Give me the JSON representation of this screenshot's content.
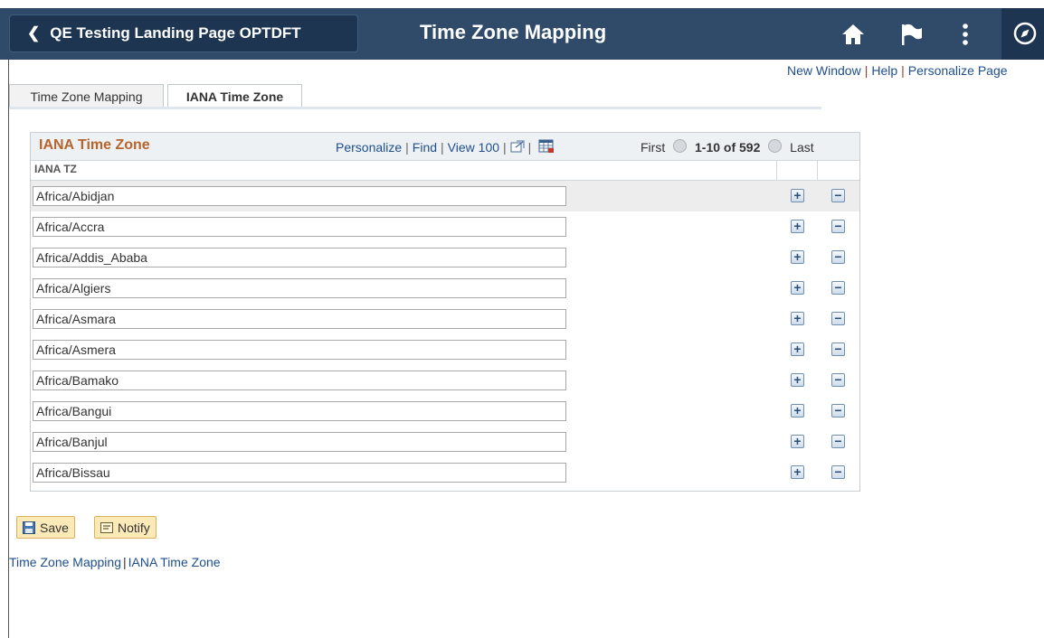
{
  "header": {
    "back_label": "QE Testing Landing Page OPTDFT",
    "title": "Time Zone Mapping",
    "bg_color": "#2f4b69"
  },
  "top_links": {
    "new_window": "New Window",
    "help": "Help",
    "personalize_page": "Personalize Page"
  },
  "tabs": [
    {
      "label": "Time Zone Mapping",
      "active": false
    },
    {
      "label": "IANA Time Zone",
      "active": true
    }
  ],
  "grid": {
    "title": "IANA Time Zone",
    "tools": {
      "personalize": "Personalize",
      "find": "Find",
      "view": "View 100"
    },
    "nav": {
      "first": "First",
      "range": "1-10 of 592",
      "last": "Last"
    },
    "column": "IANA TZ",
    "rows": [
      "Africa/Abidjan",
      "Africa/Accra",
      "Africa/Addis_Ababa",
      "Africa/Algiers",
      "Africa/Asmara",
      "Africa/Asmera",
      "Africa/Bamako",
      "Africa/Bangui",
      "Africa/Banjul",
      "Africa/Bissau"
    ],
    "add_symbol": "+",
    "delete_symbol": "−"
  },
  "buttons": {
    "save": "Save",
    "notify": "Notify"
  },
  "bottom_links": {
    "time_zone_mapping": "Time Zone Mapping",
    "iana_time_zone": "IANA Time Zone"
  }
}
